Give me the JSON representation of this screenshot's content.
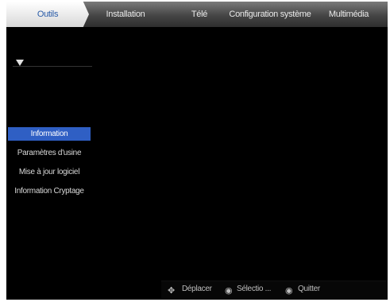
{
  "tabs": [
    {
      "label": "Outils",
      "active": true
    },
    {
      "label": "Installation",
      "active": false
    },
    {
      "label": "Télé",
      "active": false
    },
    {
      "label": "Configuration système",
      "active": false
    },
    {
      "label": "Multimédia",
      "active": false
    }
  ],
  "menu": {
    "items": [
      {
        "label": "Information",
        "selected": true
      },
      {
        "label": "Paramètres d'usine",
        "selected": false
      },
      {
        "label": "Mise à jour logiciel",
        "selected": false
      },
      {
        "label": "Information Cryptage",
        "selected": false
      }
    ]
  },
  "footer": {
    "move_label": "Déplacer",
    "select_label": "Sélectio ...",
    "exit_label": "Quitter",
    "move_icon": "dpad-icon",
    "select_icon": "ok-button-icon",
    "exit_icon": "exit-button-icon"
  },
  "colors": {
    "background": "#000000",
    "selected": "#2f5fc4",
    "active_tab_text": "#2a5ca8"
  }
}
